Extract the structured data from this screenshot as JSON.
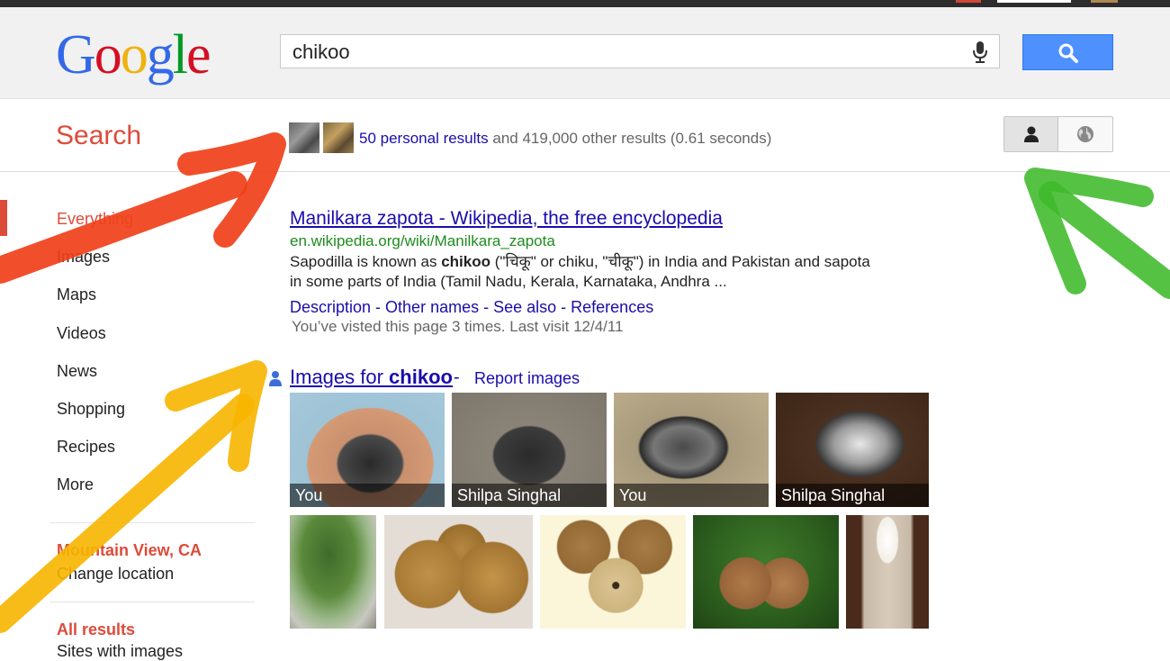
{
  "search": {
    "query": "chikoo",
    "section_label": "Search"
  },
  "results_stats": {
    "personal_link": "50 personal results",
    "rest": "and 419,000 other results (0.61 seconds)"
  },
  "nav": {
    "items": [
      {
        "label": "Everything",
        "active": true
      },
      {
        "label": "Images"
      },
      {
        "label": "Maps"
      },
      {
        "label": "Videos"
      },
      {
        "label": "News"
      },
      {
        "label": "Shopping"
      },
      {
        "label": "Recipes"
      },
      {
        "label": "More"
      }
    ],
    "location_title": "Mountain View, CA",
    "change_location": "Change location",
    "all_results": "All results",
    "sites_with_images": "Sites with images"
  },
  "result": {
    "title": "Manilkara zapota - Wikipedia, the free encyclopedia",
    "url": "en.wikipedia.org/wiki/Manilkara_zapota",
    "snippet_1_pre": "Sapodilla is known as ",
    "snippet_1_bold": "chikoo",
    "snippet_1_post": " (\"चिकू\" or chiku, \"चीकू\") in India and Pakistan and sapota",
    "snippet_2": "in some parts of India (Tamil Nadu, Kerala, Karnataka, Andhra ...",
    "sitelinks": [
      "Description",
      "Other names",
      "See also",
      "References"
    ],
    "sitelink_sep": " - ",
    "visited": "You’ve visted this page 3 times.  Last visit 12/4/11"
  },
  "images": {
    "title_pre": "Images for ",
    "title_bold": "chikoo",
    "dash": " - ",
    "report": "Report images",
    "personal_captions": [
      "You",
      "Shilpa Singhal",
      "You",
      "Shilpa Singhal"
    ]
  },
  "colors": {
    "google_blue": "#1a0dab",
    "red_accent": "#dd4b39",
    "url_green": "#1e8b1e",
    "button_blue": "#4d90fe"
  },
  "icons": [
    "mic-icon",
    "search-icon",
    "person-icon",
    "globe-icon"
  ]
}
